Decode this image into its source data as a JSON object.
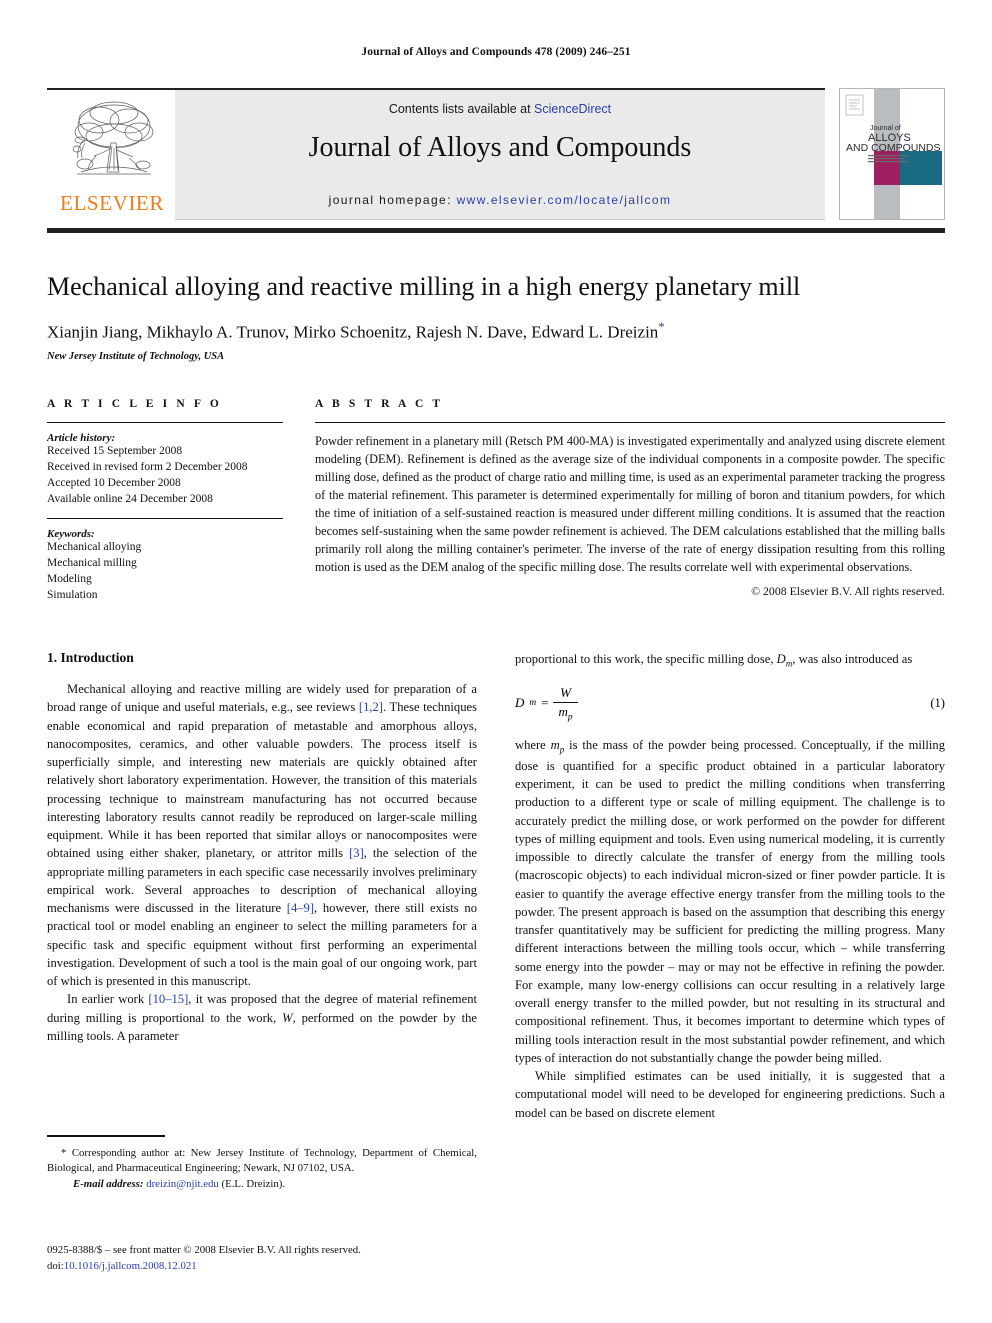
{
  "running_head": "Journal of Alloys and Compounds 478 (2009) 246–251",
  "masthead": {
    "publisher": "ELSEVIER",
    "contents_prefix": "Contents lists available at ",
    "contents_link": "ScienceDirect",
    "journal_title": "Journal of Alloys and Compounds",
    "homepage_prefix": "journal homepage: ",
    "homepage_url": "www.elsevier.com/locate/jallcom",
    "cover": {
      "line1": "Journal of",
      "line2": "ALLOYS",
      "line3": "AND COMPOUNDS",
      "subtitle": "AN INTERNATIONAL JOURNAL OF MATERIALS SCIENCE AND SOLID STATE CHEMISTRY AND PHYSICS"
    },
    "colors": {
      "elsevier_orange": "#F07E1A",
      "link_blue": "#2c3fa4",
      "band_grey": "#eaeaea",
      "cover_magenta": "#9e2060",
      "cover_teal": "#1b6a84",
      "cover_grey": "#b9bcc0"
    }
  },
  "article": {
    "title": "Mechanical alloying and reactive milling in a high energy planetary mill",
    "authors": "Xianjin Jiang, Mikhaylo A. Trunov, Mirko Schoenitz, Rajesh N. Dave, Edward L. Dreizin",
    "corresponding_marker": "*",
    "affiliation": "New Jersey Institute of Technology, USA"
  },
  "article_info": {
    "heading": "A R T I C L E    I N F O",
    "history_label": "Article history:",
    "history": [
      "Received 15 September 2008",
      "Received in revised form 2 December 2008",
      "Accepted 10 December 2008",
      "Available online 24 December 2008"
    ],
    "keywords_label": "Keywords:",
    "keywords": [
      "Mechanical alloying",
      "Mechanical milling",
      "Modeling",
      "Simulation"
    ]
  },
  "abstract": {
    "heading": "A B S T R A C T",
    "text": "Powder refinement in a planetary mill (Retsch PM 400-MA) is investigated experimentally and analyzed using discrete element modeling (DEM). Refinement is defined as the average size of the individual components in a composite powder. The specific milling dose, defined as the product of charge ratio and milling time, is used as an experimental parameter tracking the progress of the material refinement. This parameter is determined experimentally for milling of boron and titanium powders, for which the time of initiation of a self-sustained reaction is measured under different milling conditions. It is assumed that the reaction becomes self-sustaining when the same powder refinement is achieved. The DEM calculations established that the milling balls primarily roll along the milling container's perimeter. The inverse of the rate of energy dissipation resulting from this rolling motion is used as the DEM analog of the specific milling dose. The results correlate well with experimental observations.",
    "copyright": "© 2008 Elsevier B.V. All rights reserved."
  },
  "body": {
    "section1_heading": "1.  Introduction",
    "left_para1_a": "Mechanical alloying and reactive milling are widely used for preparation of a broad range of unique and useful materials, e.g., see reviews ",
    "left_para1_ref1": "[1,2]",
    "left_para1_b": ". These techniques enable economical and rapid preparation of metastable and amorphous alloys, nanocomposites, ceramics, and other valuable powders. The process itself is superficially simple, and interesting new materials are quickly obtained after relatively short laboratory experimentation. However, the transition of this materials processing technique to mainstream manufacturing has not occurred because interesting laboratory results cannot readily be reproduced on larger-scale milling equipment. While it has been reported that similar alloys or nanocomposites were obtained using either shaker, planetary, or attritor mills ",
    "left_para1_ref2": "[3]",
    "left_para1_c": ", the selection of the appropriate milling parameters in each specific case necessarily involves preliminary empirical work. Several approaches to description of mechanical alloying mechanisms were discussed in the literature ",
    "left_para1_ref3": "[4–9]",
    "left_para1_d": ", however, there still exists no practical tool or model enabling an engineer to select the milling parameters for a specific task and specific equipment without first performing an experimental investigation. Development of such a tool is the main goal of our ongoing work, part of which is presented in this manuscript.",
    "left_para2_a": "In earlier work ",
    "left_para2_ref": "[10–15]",
    "left_para2_b": ", it was proposed that the degree of material refinement during milling is proportional to the work, ",
    "left_para2_sym": "W",
    "left_para2_c": ", performed on the powder by the milling tools. A parameter",
    "right_para0_a": "proportional to this work, the specific milling dose, ",
    "right_para0_sym": "D",
    "right_para0_sub": "m",
    "right_para0_b": ", was also introduced as",
    "equation": {
      "lhs_sym": "D",
      "lhs_sub": "m",
      "eq": "=",
      "numerator": "W",
      "denominator_sym": "m",
      "denominator_sub": "p",
      "number": "(1)"
    },
    "right_para1_a": "where ",
    "right_para1_sym": "m",
    "right_para1_sub": "p",
    "right_para1_b": " is the mass of the powder being processed. Conceptually, if the milling dose is quantified for a specific product obtained in a particular laboratory experiment, it can be used to predict the milling conditions when transferring production to a different type or scale of milling equipment. The challenge is to accurately predict the milling dose, or work performed on the powder for different types of milling equipment and tools. Even using numerical modeling, it is currently impossible to directly calculate the transfer of energy from the milling tools (macroscopic objects) to each individual micron-sized or finer powder particle. It is easier to quantify the average effective energy transfer from the milling tools to the powder. The present approach is based on the assumption that describing this energy transfer quantitatively may be sufficient for predicting the milling progress. Many different interactions between the milling tools occur, which – while transferring some energy into the powder – may or may not be effective in refining the powder. For example, many low-energy collisions can occur resulting in a relatively large overall energy transfer to the milled powder, but not resulting in its structural and compositional refinement. Thus, it becomes important to determine which types of milling tools interaction result in the most substantial powder refinement, and which types of interaction do not substantially change the powder being milled.",
    "right_para2": "While simplified estimates can be used initially, it is suggested that a computational model will need to be developed for engineering predictions. Such a model can be based on discrete element"
  },
  "footnote": {
    "star": "*",
    "corresponding": "Corresponding author at: New Jersey Institute of Technology, Department of Chemical, Biological, and Pharmaceutical Engineering; Newark, NJ 07102, USA.",
    "email_label": "E-mail address:",
    "email": "dreizin@njit.edu",
    "email_person": "(E.L. Dreizin).",
    "issn_line": "0925-8388/$ – see front matter © 2008 Elsevier B.V. All rights reserved.",
    "doi_label": "doi:",
    "doi_value": "10.1016/j.jallcom.2008.12.021"
  }
}
